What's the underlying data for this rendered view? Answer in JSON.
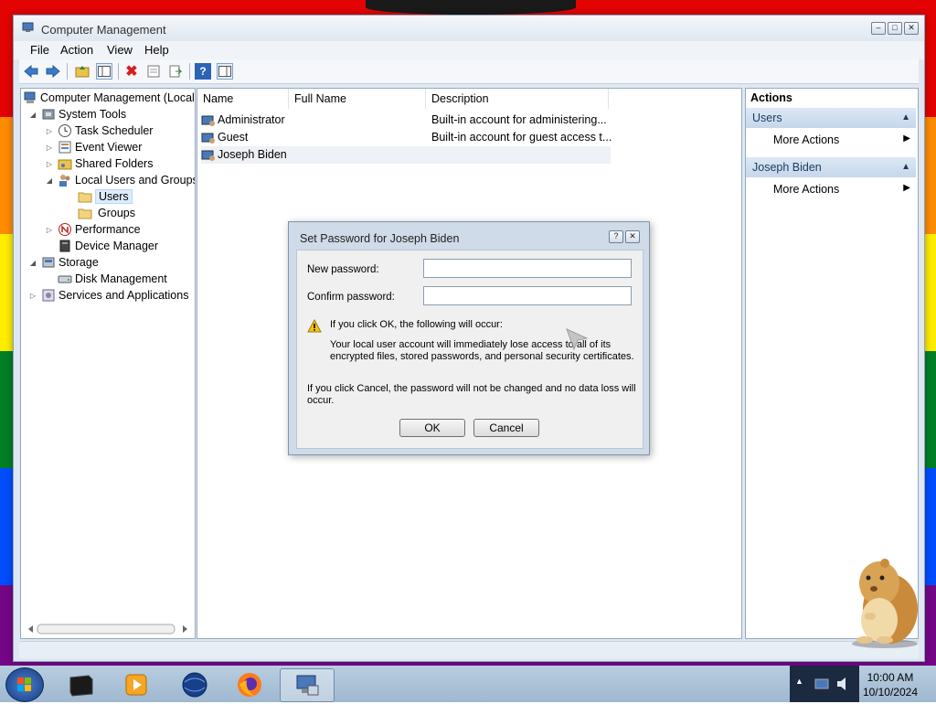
{
  "window": {
    "title": "Computer Management"
  },
  "menu": [
    "File",
    "Action",
    "View",
    "Help"
  ],
  "toolbar": [
    "back-icon",
    "forward-icon",
    "up-folder-icon",
    "show-hide-tree-icon",
    "delete-icon",
    "properties-icon",
    "export-list-icon",
    "help-icon",
    "show-hide-action-pane-icon"
  ],
  "tree": {
    "root": "Computer Management (Local",
    "system_tools": "System Tools",
    "task_scheduler": "Task Scheduler",
    "event_viewer": "Event Viewer",
    "shared_folders": "Shared Folders",
    "local_users_groups": "Local Users and Groups",
    "users": "Users",
    "groups": "Groups",
    "performance": "Performance",
    "device_manager": "Device Manager",
    "storage": "Storage",
    "disk_management": "Disk Management",
    "services_apps": "Services and Applications"
  },
  "list": {
    "columns": [
      "Name",
      "Full Name",
      "Description"
    ],
    "rows": [
      {
        "name": "Administrator",
        "full_name": "",
        "description": "Built-in account for administering..."
      },
      {
        "name": "Guest",
        "full_name": "",
        "description": "Built-in account for guest access t..."
      },
      {
        "name": "Joseph Biden",
        "full_name": "",
        "description": ""
      }
    ]
  },
  "actions": {
    "header": "Actions",
    "sections": [
      {
        "title": "Users",
        "item": "More Actions"
      },
      {
        "title": "Joseph Biden",
        "item": "More Actions"
      }
    ]
  },
  "dialog": {
    "title": "Set Password for Joseph Biden",
    "new_password_label": "New password:",
    "confirm_password_label": "Confirm password:",
    "new_password_value": "",
    "confirm_password_value": "",
    "warning_heading": "If you click OK, the following will occur:",
    "warning_body_1": "Your local user account will immediately lose access to all of its",
    "warning_body_2": "encrypted files, stored passwords, and personal security certificates.",
    "cancel_note_1": "If you click Cancel, the password will not be changed and no data loss will",
    "cancel_note_2": "occur.",
    "ok_label": "OK",
    "cancel_label": "Cancel"
  },
  "taskbar": {
    "apps": [
      "terminal-icon",
      "media-player-icon",
      "globe-icon",
      "firefox-icon",
      "computer-management-icon"
    ],
    "time": "10:00 AM",
    "date": "10/10/2024"
  },
  "colors": {
    "rainbow": [
      "#e40303",
      "#ff8c00",
      "#ffed00",
      "#008026",
      "#004dff",
      "#750787"
    ],
    "accent": "#dce8f5"
  }
}
